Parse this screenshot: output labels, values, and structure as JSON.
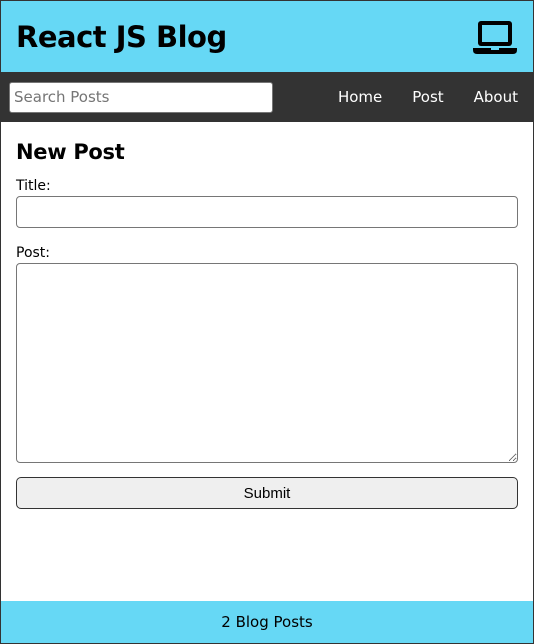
{
  "header": {
    "title": "React JS Blog",
    "icon": "laptop-icon",
    "background": "#66d8f5"
  },
  "nav": {
    "search": {
      "placeholder": "Search Posts",
      "value": ""
    },
    "links": [
      {
        "label": "Home"
      },
      {
        "label": "Post"
      },
      {
        "label": "About"
      }
    ],
    "background": "#333333"
  },
  "main": {
    "heading": "New Post",
    "title_field": {
      "label": "Title:",
      "value": ""
    },
    "post_field": {
      "label": "Post:",
      "value": ""
    },
    "submit_label": "Submit"
  },
  "footer": {
    "text": "2 Blog Posts"
  }
}
